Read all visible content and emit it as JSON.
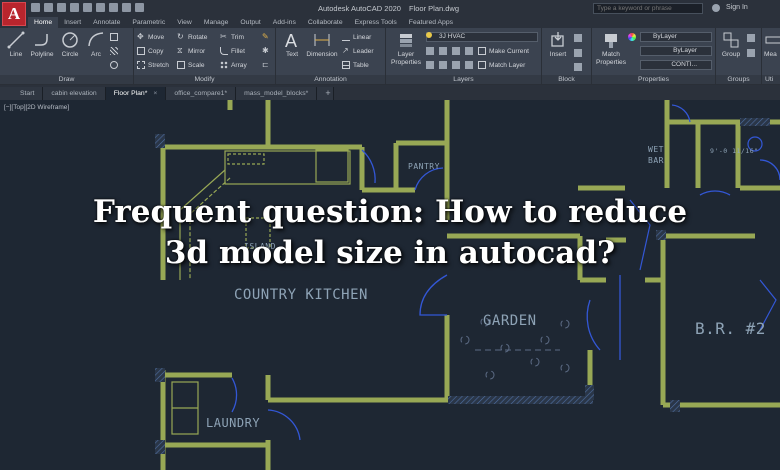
{
  "app": {
    "logo_letter": "A",
    "title": "Autodesk AutoCAD 2020",
    "file_name": "Floor Plan.dwg",
    "search_placeholder": "Type a keyword or phrase",
    "sign_in": "Sign In"
  },
  "ribbon_tabs": [
    "Home",
    "Insert",
    "Annotate",
    "Parametric",
    "View",
    "Manage",
    "Output",
    "Add-ins",
    "Collaborate",
    "Express Tools",
    "Featured Apps"
  ],
  "active_ribbon_tab": "Home",
  "ribbon": {
    "draw": {
      "title": "Draw",
      "tools": [
        "Line",
        "Polyline",
        "Circle",
        "Arc"
      ]
    },
    "modify": {
      "title": "Modify",
      "tools": [
        "Move",
        "Rotate",
        "Trim",
        "Copy",
        "Mirror",
        "Fillet",
        "Stretch",
        "Scale",
        "Array"
      ]
    },
    "annotation": {
      "title": "Annotation",
      "tools": [
        "Text",
        "Dimension",
        "Linear",
        "Leader",
        "Table"
      ]
    },
    "layers": {
      "title": "Layers",
      "tools": [
        "Layer Properties",
        "Make Current",
        "Match Layer"
      ],
      "current_layer": "3J HVAC"
    },
    "block": {
      "title": "Block",
      "tools": [
        "Insert"
      ]
    },
    "properties": {
      "title": "Properties",
      "tools": [
        "Match Properties"
      ],
      "color": "ByLayer",
      "lineweight": "ByLayer",
      "linetype": "CONTI..."
    },
    "groups": {
      "title": "Groups",
      "tools": [
        "Group"
      ]
    },
    "utilities": {
      "title": "Uti",
      "tools": [
        "Mea"
      ]
    }
  },
  "doc_tabs": [
    {
      "label": "Start",
      "active": false
    },
    {
      "label": "cabin elevation",
      "active": false
    },
    {
      "label": "Floor Plan*",
      "active": true
    },
    {
      "label": "office_compare1*",
      "active": false
    },
    {
      "label": "mass_model_blocks*",
      "active": false
    }
  ],
  "add_tab": "+",
  "viewport_label": "[−][Top][2D Wireframe]",
  "rooms": {
    "country_kitchen": "COUNTRY KITCHEN",
    "garden": "GARDEN",
    "br2": "B.R. #2",
    "laundry": "LAUNDRY",
    "pantry": "PANTRY",
    "island": "ISLAND",
    "wet_bar_1": "WET",
    "wet_bar_2": "BAR",
    "dimension": "9'-0 11/16\""
  },
  "headline": {
    "line1": "Frequent question: How to reduce",
    "line2": "3d model size in autocad?"
  },
  "colors": {
    "wall": "#98a855",
    "wall_hatch": "#4f6fa3",
    "door": "#3357d6",
    "background": "#1e2733",
    "brand_red": "#b9252d"
  }
}
